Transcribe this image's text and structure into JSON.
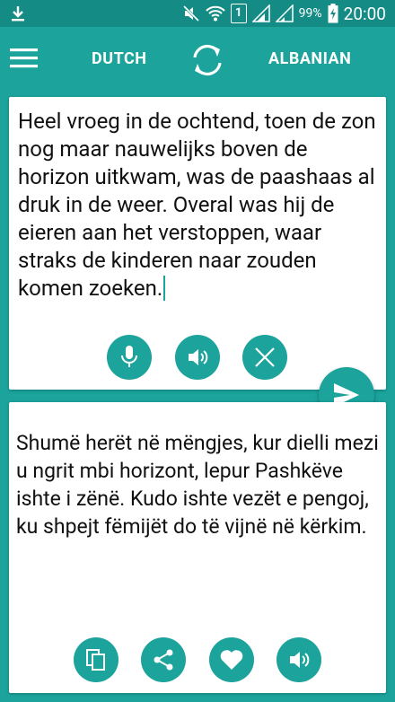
{
  "status_bar": {
    "battery": "99%",
    "time": "20:00",
    "sim": "1"
  },
  "toolbar": {
    "source_language": "DUTCH",
    "target_language": "ALBANIAN"
  },
  "source": {
    "text": "Heel vroeg in de ochtend, toen de zon nog maar nauwelijks boven de horizon uitkwam, was de paashaas al druk in de weer. Overal was hij de eieren aan het verstoppen, waar straks de kinderen naar zouden komen zoeken."
  },
  "translation": {
    "text": "Shumë herët në mëngjes, kur dielli mezi u ngrit mbi horizont, lepur Pashkëve ishte i zënë. Kudo ishte vezët e pengoj, ku shpejt fëmijët do të vijnë në kërkim."
  },
  "colors": {
    "primary": "#1ba39c",
    "status_bar": "#148c85",
    "card": "#ffffff"
  },
  "icons": {
    "menu": "menu-icon",
    "swap": "swap-icon",
    "mic": "microphone-icon",
    "speak": "speaker-icon",
    "clear": "close-icon",
    "send": "send-icon",
    "copy": "copy-icon",
    "share": "share-icon",
    "favorite": "heart-icon"
  }
}
